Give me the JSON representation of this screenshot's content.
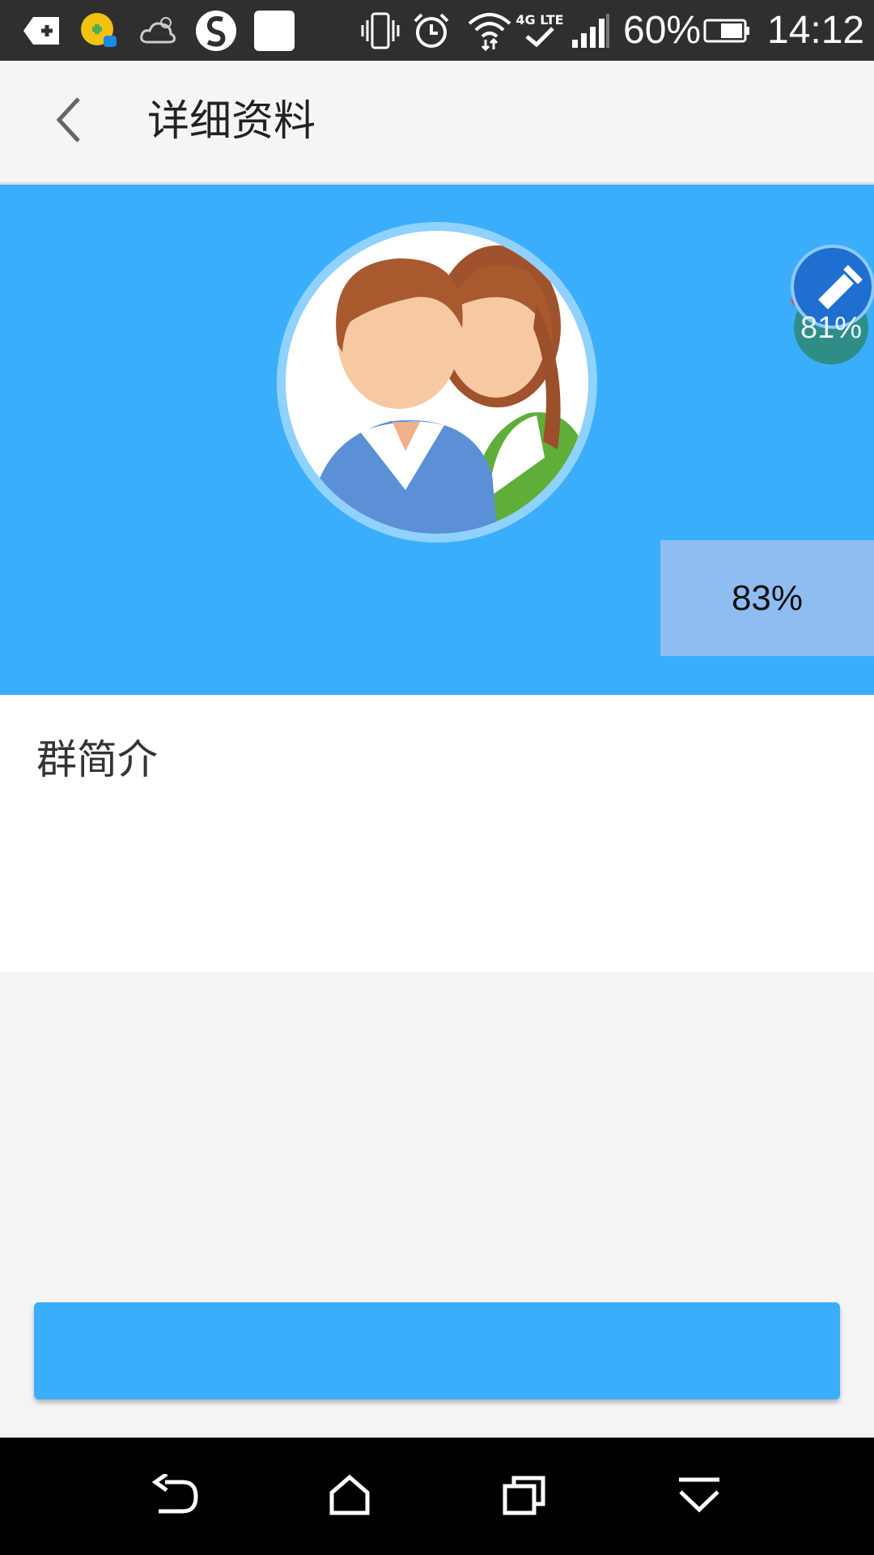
{
  "status_bar": {
    "battery_percent": "60%",
    "time": "14:12",
    "network_label": "4G LTE"
  },
  "header": {
    "title": "详细资料"
  },
  "banner": {
    "progress_label": "83%",
    "floating_widget_label": "81%"
  },
  "intro": {
    "label": "群简介"
  },
  "action_button": {
    "label": ""
  },
  "colors": {
    "accent": "#3aaefb",
    "status_bar": "#2f2f2f",
    "nav_bar": "#000000"
  },
  "icons": {
    "back": "chevron-left-icon",
    "avatar": "group-avatar-icon",
    "nav_back": "back-arrow-icon",
    "nav_home": "home-icon",
    "nav_recent": "recent-apps-icon",
    "nav_menu": "chevron-down-icon"
  }
}
